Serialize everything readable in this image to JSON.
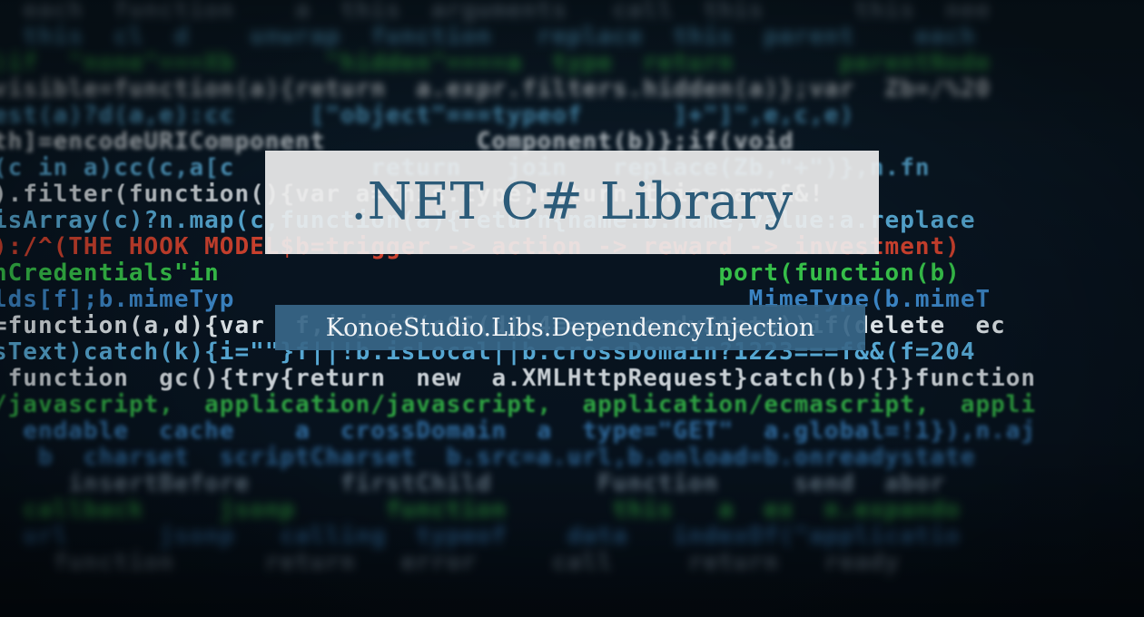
{
  "banner": {
    "title": ".NET C# Library",
    "subtitle": "KonoeStudio.Libs.DependencyInjection"
  },
  "background": {
    "code_lines": [
      {
        "text": "  each  function    a  this  arguments   call  this      this  nee",
        "color": "gray"
      },
      {
        "text": "  this  cl  d    unwrap  function   replace  this  parent    each  ",
        "color": "cyan"
      },
      {
        "text": ")if  \"none\"===Xb      \"hidden\"====a  type  return       parentNode",
        "color": "green"
      },
      {
        "text": "visible=function(a){return  a.expr.filters.hidden(a)};var  Zb=/%20",
        "color": "white"
      },
      {
        "text": "est(a)?d(a,e):cc     [\"object\"===typeof      ]+\"]\",e,c,e)",
        "color": "cyan"
      },
      {
        "text": "th]=encodeURIComponent          Component(b)};if(void",
        "color": "white"
      },
      {
        "text": "(c in a)cc(c,a[c         return   join   replace(Zb,\"+\")},n.fn",
        "color": "cyan"
      },
      {
        "text": ").filter(function(){var a=this.type;return this.name&&!",
        "color": "white"
      },
      {
        "text": "isArray(c)?n.map(c,function(a){return{name:b.name,value:a.replace",
        "color": "cyan"
      },
      {
        "text": "):/^(THE HOOK MODEL$b=trigger -> action -> reward -> investment)",
        "color": "red"
      },
      {
        "text": "nCredentials\"in                                 port(function(b)",
        "color": "green"
      },
      {
        "text": "lds[f];b.mimeTyp                                  MimeType(b.mimeT",
        "color": "blue"
      },
      {
        "text": "=function(a,d){var  f,i,j;if(c&&(d||4===g.readyState))if(delete  ec",
        "color": "white"
      },
      {
        "text": "sText)catch(k){i=\"\"}f||!b.isLocal||b.crossDomain?1223===f&&(f=204",
        "color": "cyan"
      },
      {
        "text": " function  gc(){try{return  new  a.XMLHttpRequest}catch(b){}}function",
        "color": "white"
      },
      {
        "text": "/javascript,  application/javascript,  application/ecmascript,  appli",
        "color": "green"
      },
      {
        "text": "  endable  cache    a  crossDomain  a  type=\"GET\"  a.global=!1}),n.aj",
        "color": "blue"
      },
      {
        "text": "   b  charset  scriptCharset  b.src=a.url,b.onload=b.onreadystate",
        "color": "blue"
      },
      {
        "text": "     insertBefore      firstChild       Function     send  abor",
        "color": "gray"
      },
      {
        "text": "  callback     jsonp      function       this   a  ex  n.expando",
        "color": "green"
      },
      {
        "text": "  url      jsonp   calling  typeof    data   indexOf(\"applicatio",
        "color": "blue"
      },
      {
        "text": "    function      return   error     call     return   ready",
        "color": "gray"
      }
    ]
  }
}
